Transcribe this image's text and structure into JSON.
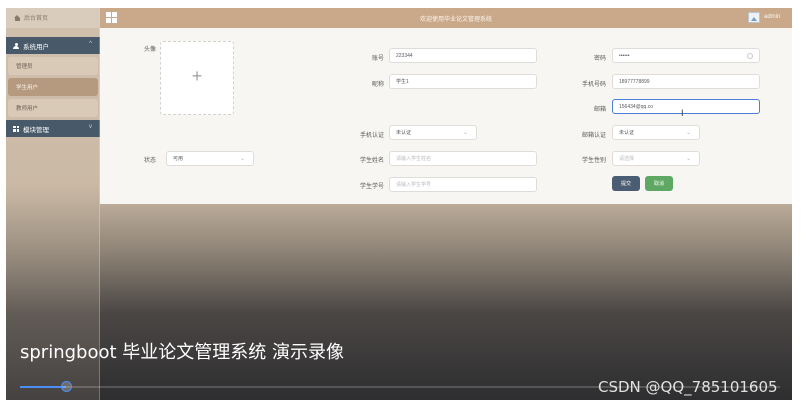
{
  "header": {
    "home_label": "后台首页",
    "welcome_title": "欢迎使用毕业论文管理系统",
    "user_name": "admin"
  },
  "sidebar": {
    "groups": [
      {
        "label": "系统用户",
        "expanded": true,
        "items": [
          {
            "label": "管理员",
            "active": false
          },
          {
            "label": "学生用户",
            "active": true
          },
          {
            "label": "教师用户",
            "active": false
          }
        ]
      },
      {
        "label": "模块管理",
        "expanded": false
      }
    ]
  },
  "form": {
    "avatar_label": "头像",
    "upload_placeholder": "+",
    "account": {
      "label": "账号",
      "value": "223344"
    },
    "password": {
      "label": "密码",
      "value": "••••••"
    },
    "nickname": {
      "label": "昵称",
      "value": "学生1"
    },
    "phone": {
      "label": "手机号码",
      "value": "18977778899"
    },
    "email": {
      "label": "邮箱",
      "value": "156434@qq.co"
    },
    "phone_verify": {
      "label": "手机认证",
      "value": "未认证"
    },
    "email_verify": {
      "label": "邮箱认证",
      "value": "未认证"
    },
    "status": {
      "label": "状态",
      "value": "可用"
    },
    "student_name": {
      "label": "学生姓名",
      "placeholder": "请输入学生姓名"
    },
    "student_gender": {
      "label": "学生性别",
      "placeholder": "请选择"
    },
    "student_id": {
      "label": "学生学号",
      "placeholder": "请输入学生学号"
    },
    "submit_label": "提交",
    "cancel_label": "取消"
  },
  "video": {
    "caption": "springboot 毕业论文管理系统 演示录像",
    "progress": 0.06
  },
  "watermark": "CSDN @QQ_785101605",
  "colors": {
    "menu_head": "#485a6a",
    "sidebar_active": "#b59a7f",
    "header_bar": "#c9a98a",
    "submit": "#4a5d73",
    "cancel": "#5ea863",
    "focus": "#4a7fd6",
    "progress": "#4c8ff2"
  },
  "icons": [
    "home-icon",
    "grid-icon",
    "avatar-icon",
    "user-icon",
    "module-icon",
    "chevron-up-icon",
    "chevron-down-icon",
    "eye-icon"
  ]
}
